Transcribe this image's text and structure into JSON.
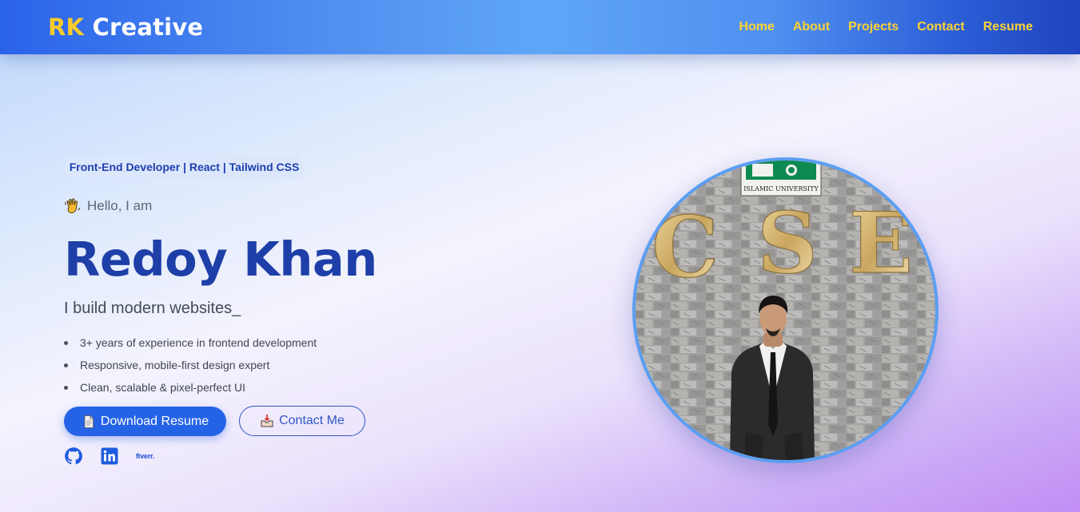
{
  "nav": {
    "brand_prefix": "RK",
    "brand_suffix": "Creative",
    "links": [
      "Home",
      "About",
      "Projects",
      "Contact",
      "Resume"
    ]
  },
  "hero": {
    "tagline": "Front-End Developer | React | Tailwind CSS",
    "hello_icon": "waving-hand-icon",
    "hello": "Hello, I am",
    "name": "Redoy Khan",
    "subtitle": "I build modern websites",
    "cursor": "_",
    "features": [
      "3+ years of experience in frontend development",
      "Responsive, mobile-first design expert",
      "Clean, scalable & pixel-perfect UI"
    ],
    "download_button": "Download Resume",
    "download_icon": "document-icon",
    "contact_button": "Contact Me",
    "contact_icon": "inbox-tray-icon",
    "socials": [
      "github-icon",
      "linkedin-icon",
      "fiverr-icon"
    ],
    "fiverr_label": "fiverr."
  },
  "portrait": {
    "sign_text": "ISLAMIC UNIVERSITY",
    "wall_letters": [
      "C",
      "S",
      "E"
    ]
  },
  "colors": {
    "primary": "#2563e6",
    "name": "#1e3fa8",
    "nav_link": "#fdd234",
    "brand_accent": "#f7cb2c",
    "portrait_border": "#5b9ef2"
  }
}
